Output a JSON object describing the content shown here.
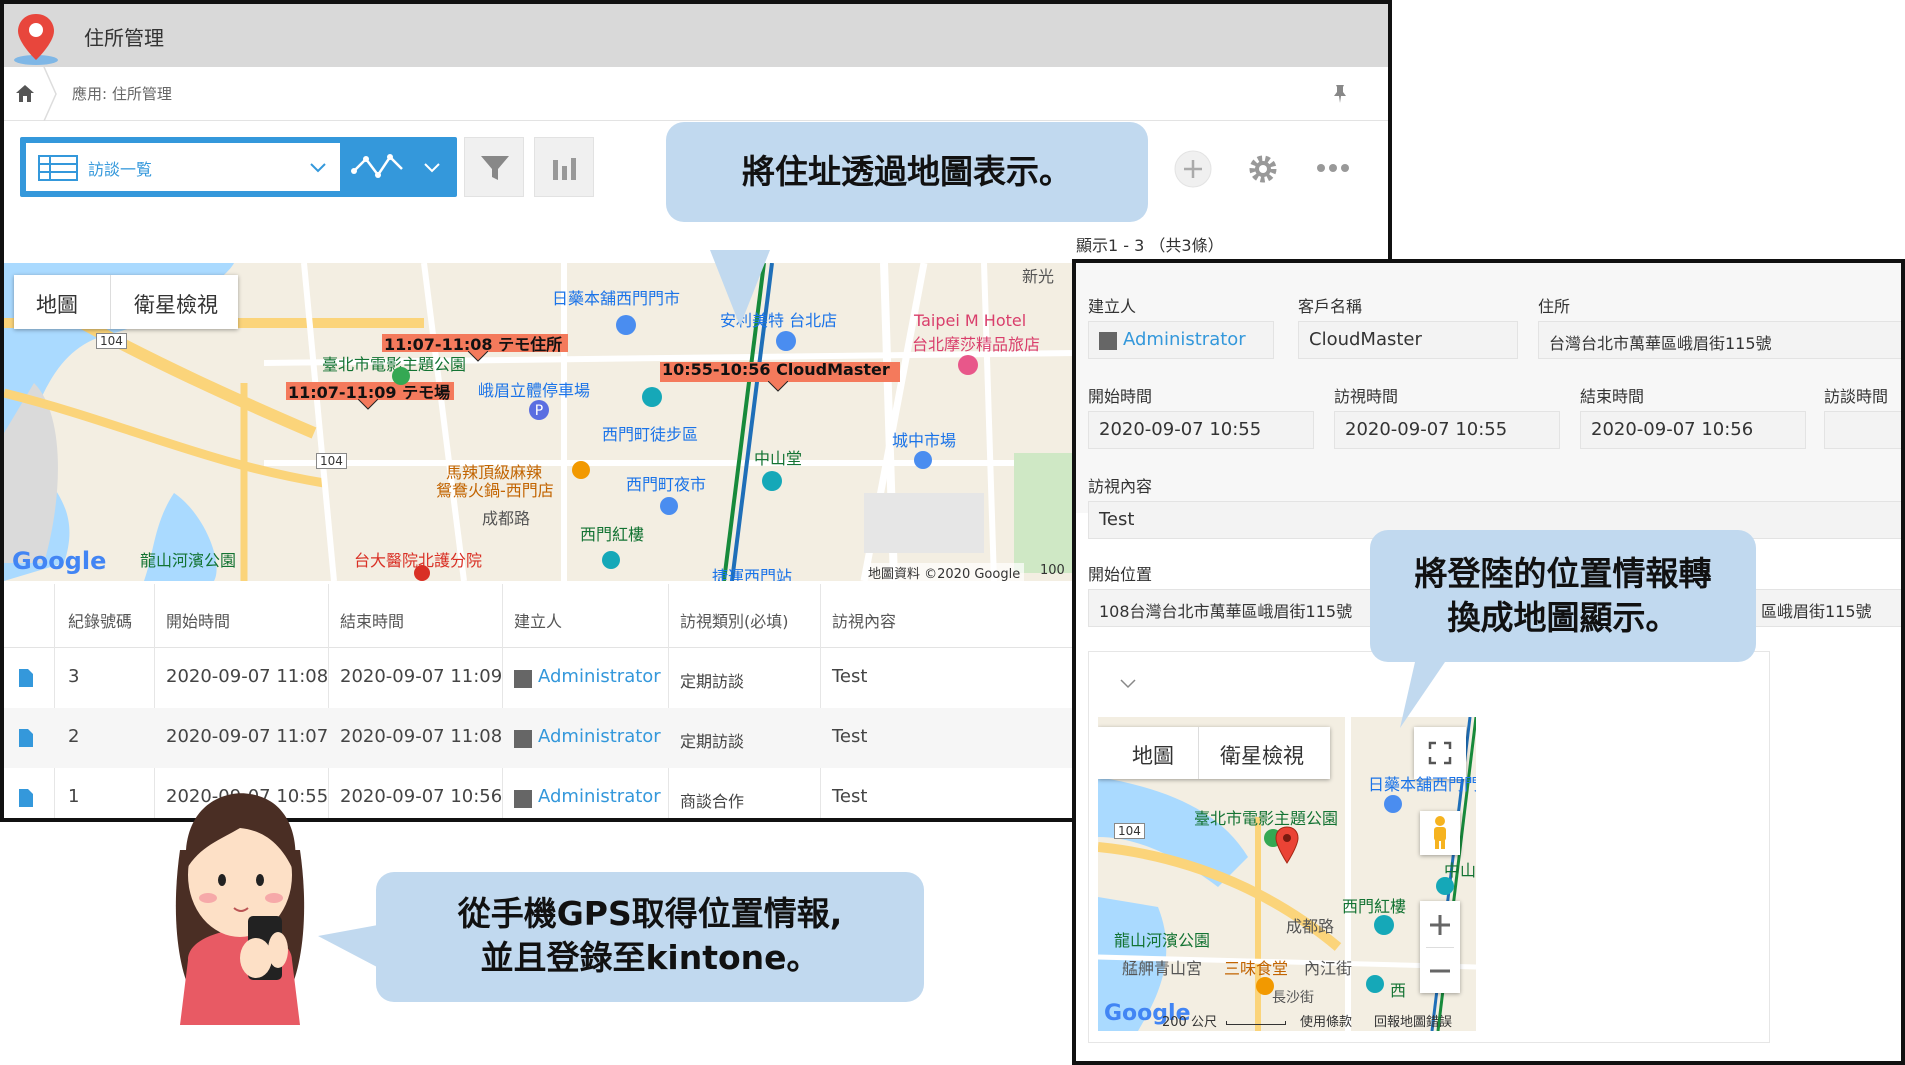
{
  "app": {
    "title": "住所管理",
    "breadcrumb": "應用: 住所管理"
  },
  "toolbar": {
    "view_label": "訪談一覧",
    "records_count": "顯示1 - 3 （共3條）"
  },
  "map_tabs": {
    "map": "地圖",
    "satellite": "衛星檢視"
  },
  "main_map": {
    "markers": [
      {
        "label": "11:07-11:08 テモ住所"
      },
      {
        "label": "11:07-11:09 テモ場"
      },
      {
        "label": "10:55-10:56 CloudMaster"
      }
    ],
    "places": {
      "pharmacy": "日藥本舖西門門市",
      "anmate": "安利美特 台北店",
      "hotel_1": "Taipei M Hotel",
      "hotel_2": "台北摩莎精品旅店",
      "film_park": "臺北市電影主題公園",
      "parking": "峨眉立體停車場",
      "ximending": "西門町徒步區",
      "chengzhong": "城中市場",
      "zhongshan": "中山堂",
      "hotpot_1": "馬辣頂級麻辣",
      "hotpot_2": "鴛鴦火鍋-西門店",
      "night_market": "西門町夜市",
      "red_house": "西門紅樓",
      "longshan_park": "龍山河濱公園",
      "hospital": "台大醫院北護分院",
      "station": "捷運西門站",
      "chengdu": "成都路",
      "new": "新光",
      "road_104": "104",
      "google": "Google",
      "copyright": "地圖資料 ©2020 Google",
      "scale": "100"
    }
  },
  "table": {
    "headers": [
      "紀錄號碼",
      "開始時間",
      "結束時間",
      "建立人",
      "訪視類別(必填)",
      "訪視內容"
    ],
    "rows": [
      {
        "id": "3",
        "start": "2020-09-07 11:08",
        "end": "2020-09-07 11:09",
        "creator": "Administrator",
        "category": "定期訪談",
        "content": "Test"
      },
      {
        "id": "2",
        "start": "2020-09-07 11:07",
        "end": "2020-09-07 11:08",
        "creator": "Administrator",
        "category": "定期訪談",
        "content": "Test"
      },
      {
        "id": "1",
        "start": "2020-09-07 10:55",
        "end": "2020-09-07 10:56",
        "creator": "Administrator",
        "category": "商談合作",
        "content": "Test"
      }
    ]
  },
  "detail": {
    "creator_label": "建立人",
    "creator": "Administrator",
    "customer_label": "客戶名稱",
    "customer": "CloudMaster",
    "address_label": "住所",
    "address": "台灣台北市萬華區峨眉街115號",
    "start_label": "開始時間",
    "start": "2020-09-07 10:55",
    "visit_label": "訪視時間",
    "visit": "2020-09-07 10:55",
    "end_label": "結束時間",
    "end": "2020-09-07 10:56",
    "interview_label": "訪談時間",
    "content_label": "訪視內容",
    "content": "Test",
    "location_label": "開始位置",
    "location": "108台灣台北市萬華區峨眉街115號",
    "location_right": "區峨眉街115號",
    "map": {
      "film_park": "臺北市電影主題公園",
      "red_house": "西門紅樓",
      "longshan_park": "龍山河濱公園",
      "temple": "艋舺青山宮",
      "restaurant": "三味食堂",
      "pharmacy": "日藥本舖西門門",
      "chengdu": "成都路",
      "neijiang": "內江街",
      "changsha": "長沙街",
      "zhongshan": "中山",
      "xi": "西",
      "road_104": "104",
      "scale": "200 公尺",
      "terms": "使用條款",
      "report": "回報地圖錯誤",
      "google": "Google"
    }
  },
  "callouts": {
    "map_display": "將住址透過地圖表示。",
    "convert_line1": "將登陸的位置情報轉",
    "convert_line2": "換成地圖顯示。",
    "gps_line1": "從手機GPS取得位置情報,",
    "gps_line2": "並且登錄至kintone。"
  },
  "colors": {
    "accent": "#3498db",
    "header_bg": "#d9d9d9",
    "bubble": "#c1d9ef",
    "marker": "#f47a5c"
  }
}
